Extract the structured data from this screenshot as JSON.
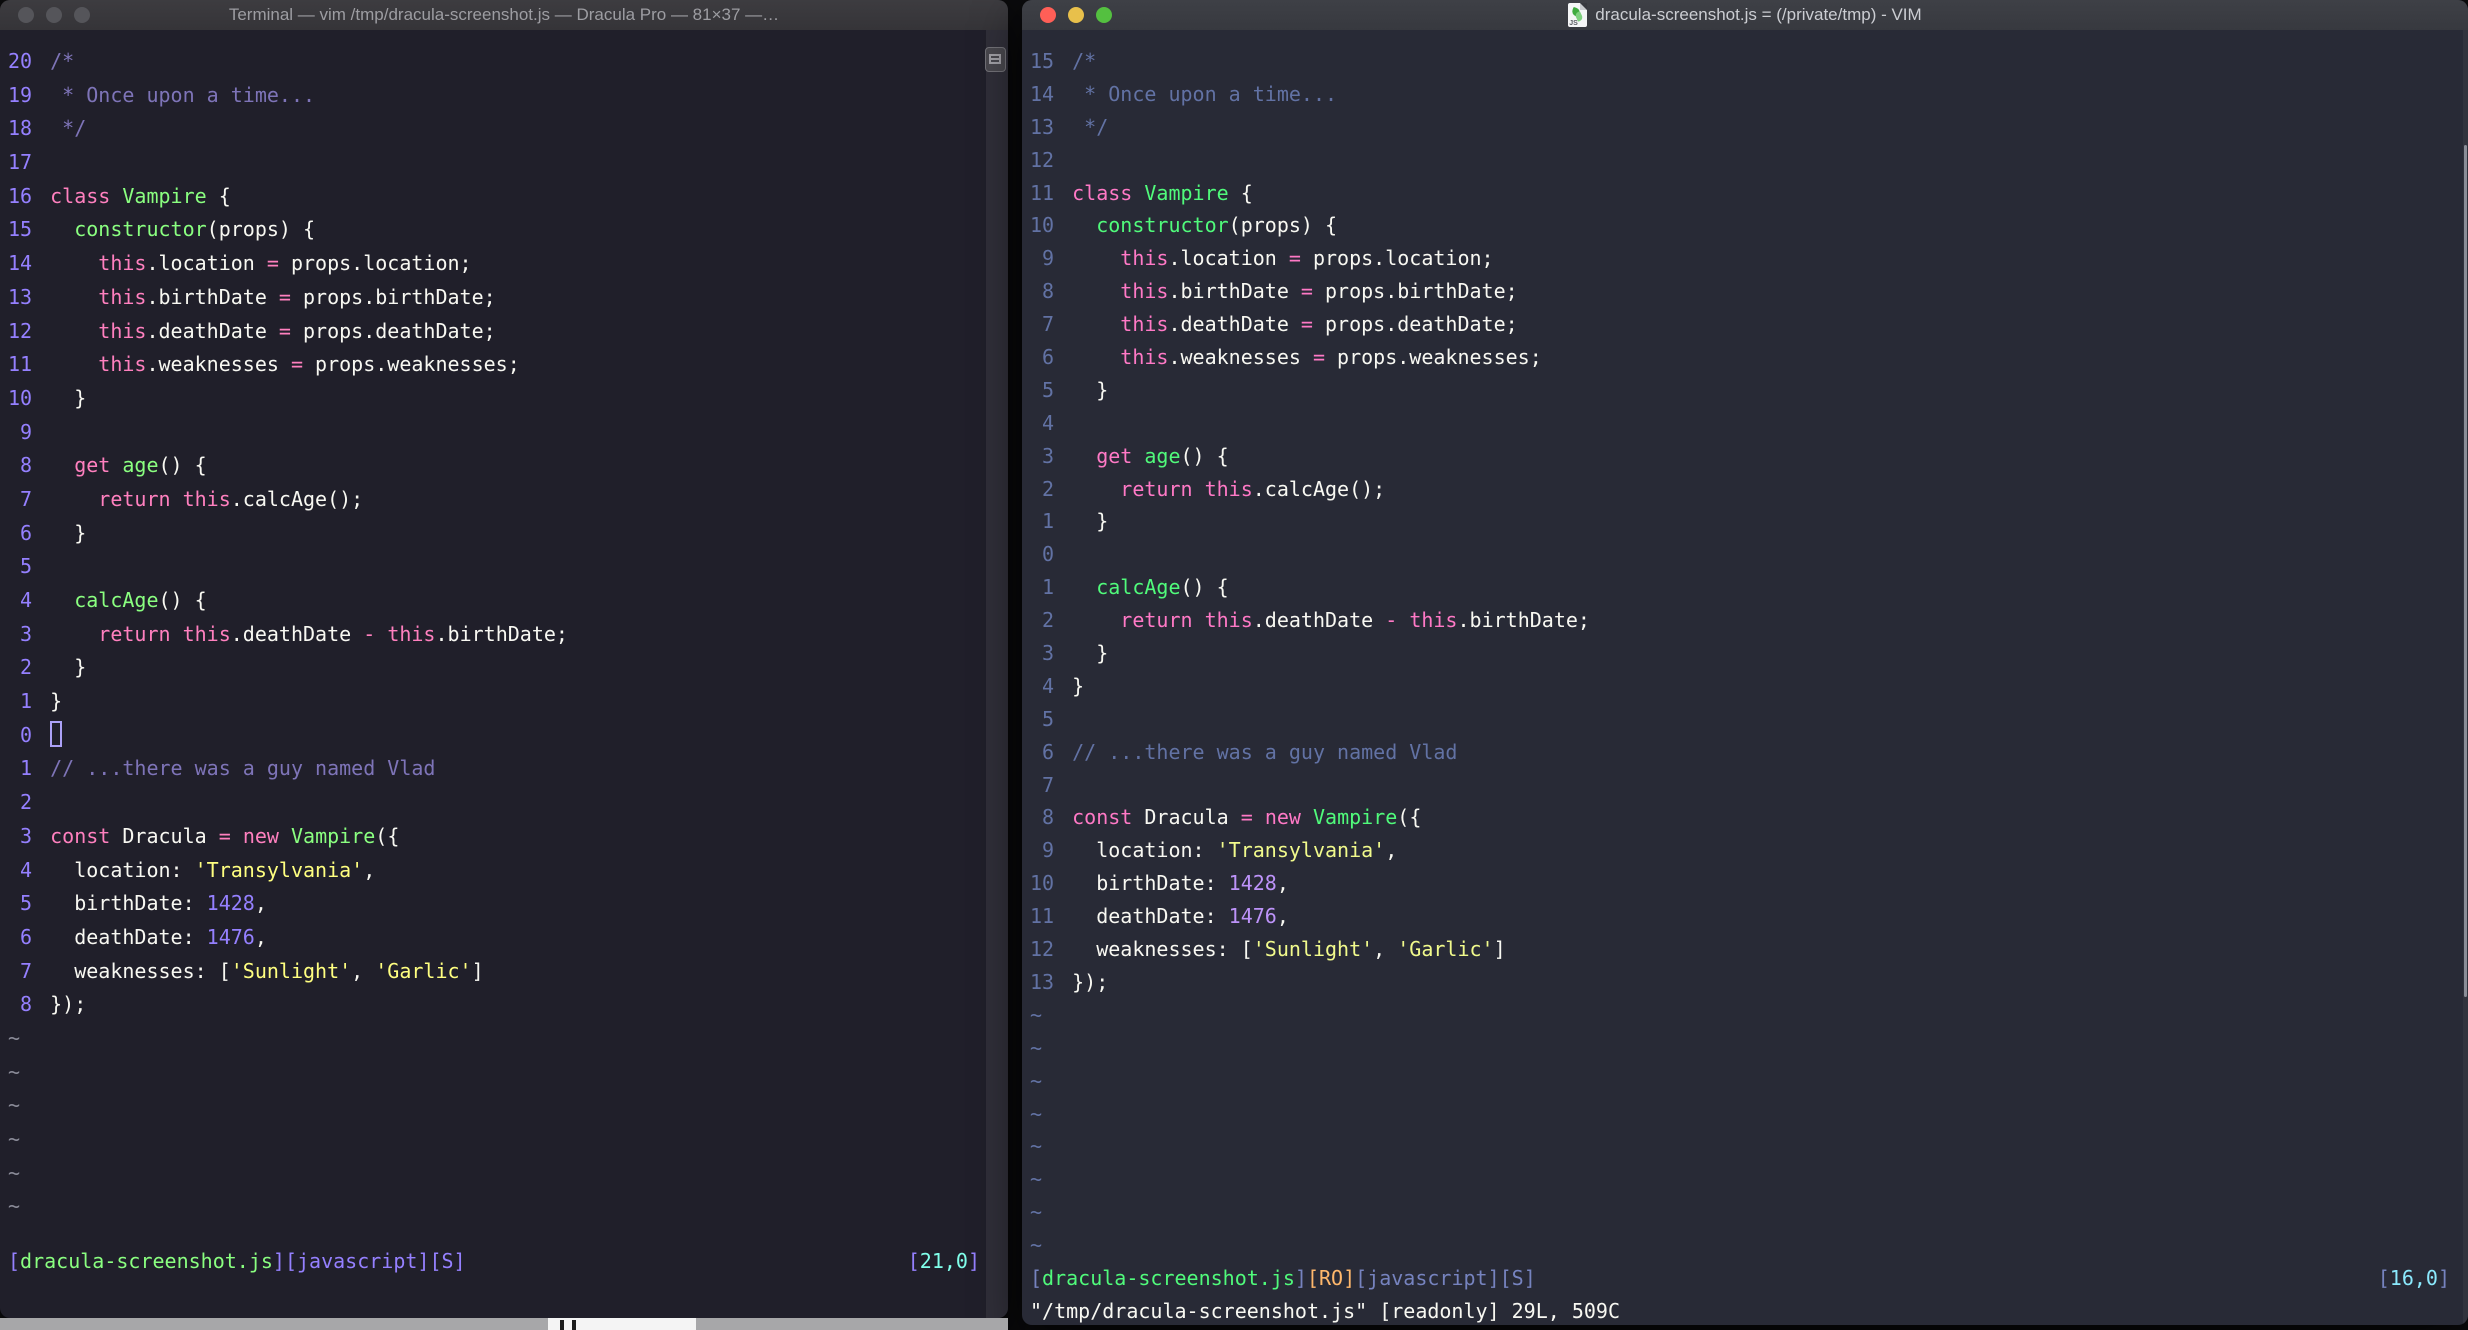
{
  "code": [
    {
      "segs": [
        [
          "com",
          "/*"
        ]
      ]
    },
    {
      "segs": [
        [
          "com",
          " * Once upon a time..."
        ]
      ]
    },
    {
      "segs": [
        [
          "com",
          " */"
        ]
      ]
    },
    {
      "segs": []
    },
    {
      "segs": [
        [
          "kw",
          "class"
        ],
        [
          "fg",
          " "
        ],
        [
          "fn",
          "Vampire"
        ],
        [
          "fg",
          " {"
        ]
      ]
    },
    {
      "segs": [
        [
          "fg",
          "  "
        ],
        [
          "fn",
          "constructor"
        ],
        [
          "fg",
          "(props) {"
        ]
      ]
    },
    {
      "segs": [
        [
          "fg",
          "    "
        ],
        [
          "kw",
          "this"
        ],
        [
          "fg",
          ".location "
        ],
        [
          "kw",
          "="
        ],
        [
          "fg",
          " props.location;"
        ]
      ]
    },
    {
      "segs": [
        [
          "fg",
          "    "
        ],
        [
          "kw",
          "this"
        ],
        [
          "fg",
          ".birthDate "
        ],
        [
          "kw",
          "="
        ],
        [
          "fg",
          " props.birthDate;"
        ]
      ]
    },
    {
      "segs": [
        [
          "fg",
          "    "
        ],
        [
          "kw",
          "this"
        ],
        [
          "fg",
          ".deathDate "
        ],
        [
          "kw",
          "="
        ],
        [
          "fg",
          " props.deathDate;"
        ]
      ]
    },
    {
      "segs": [
        [
          "fg",
          "    "
        ],
        [
          "kw",
          "this"
        ],
        [
          "fg",
          ".weaknesses "
        ],
        [
          "kw",
          "="
        ],
        [
          "fg",
          " props.weaknesses;"
        ]
      ]
    },
    {
      "segs": [
        [
          "fg",
          "  }"
        ]
      ]
    },
    {
      "segs": []
    },
    {
      "segs": [
        [
          "fg",
          "  "
        ],
        [
          "kw",
          "get"
        ],
        [
          "fg",
          " "
        ],
        [
          "fn",
          "age"
        ],
        [
          "fg",
          "() {"
        ]
      ]
    },
    {
      "segs": [
        [
          "fg",
          "    "
        ],
        [
          "kw",
          "return"
        ],
        [
          "fg",
          " "
        ],
        [
          "kw",
          "this"
        ],
        [
          "fg",
          ".calcAge();"
        ]
      ]
    },
    {
      "segs": [
        [
          "fg",
          "  }"
        ]
      ]
    },
    {
      "segs": []
    },
    {
      "segs": [
        [
          "fg",
          "  "
        ],
        [
          "fn",
          "calcAge"
        ],
        [
          "fg",
          "() {"
        ]
      ]
    },
    {
      "segs": [
        [
          "fg",
          "    "
        ],
        [
          "kw",
          "return"
        ],
        [
          "fg",
          " "
        ],
        [
          "kw",
          "this"
        ],
        [
          "fg",
          ".deathDate "
        ],
        [
          "kw",
          "-"
        ],
        [
          "fg",
          " "
        ],
        [
          "kw",
          "this"
        ],
        [
          "fg",
          ".birthDate;"
        ]
      ]
    },
    {
      "segs": [
        [
          "fg",
          "  }"
        ]
      ]
    },
    {
      "segs": [
        [
          "fg",
          "}"
        ]
      ]
    },
    {
      "segs": []
    },
    {
      "segs": [
        [
          "com",
          "// ...there was a guy named Vlad"
        ]
      ]
    },
    {
      "segs": []
    },
    {
      "segs": [
        [
          "kw",
          "const"
        ],
        [
          "fg",
          " Dracula "
        ],
        [
          "kw",
          "="
        ],
        [
          "fg",
          " "
        ],
        [
          "kw",
          "new"
        ],
        [
          "fg",
          " "
        ],
        [
          "fn",
          "Vampire"
        ],
        [
          "fg",
          "({"
        ]
      ]
    },
    {
      "segs": [
        [
          "fg",
          "  location: "
        ],
        [
          "st",
          "'Transylvania'"
        ],
        [
          "fg",
          ","
        ]
      ]
    },
    {
      "segs": [
        [
          "fg",
          "  birthDate: "
        ],
        [
          "nm",
          "1428"
        ],
        [
          "fg",
          ","
        ]
      ]
    },
    {
      "segs": [
        [
          "fg",
          "  deathDate: "
        ],
        [
          "nm",
          "1476"
        ],
        [
          "fg",
          ","
        ]
      ]
    },
    {
      "segs": [
        [
          "fg",
          "  weaknesses: ["
        ],
        [
          "st",
          "'Sunlight'"
        ],
        [
          "fg",
          ", "
        ],
        [
          "st",
          "'Garlic'"
        ],
        [
          "fg",
          "]"
        ]
      ]
    },
    {
      "segs": [
        [
          "fg",
          "});"
        ]
      ]
    }
  ],
  "left_window": {
    "title": "Terminal — vim /tmp/dracula-screenshot.js — Dracula Pro — 81×37 —…",
    "rel_numbers": [
      "20",
      "19",
      "18",
      "17",
      "16",
      "15",
      "14",
      "13",
      "12",
      "11",
      "10",
      "9",
      "8",
      "7",
      "6",
      "5",
      "4",
      "3",
      "2",
      "1",
      "0",
      "1",
      "2",
      "3",
      "4",
      "5",
      "6",
      "7",
      "8"
    ],
    "cursor_row": 20,
    "cursor_visible": true,
    "tilde_count": 6,
    "tilde_char": "~",
    "status_left": [
      [
        "p",
        "["
      ],
      [
        "g",
        "dracula-screenshot.js"
      ],
      [
        "p",
        "][javascript][S]"
      ]
    ],
    "status_right": [
      [
        "p",
        "["
      ],
      [
        "cy",
        "21,0"
      ],
      [
        "p",
        "]"
      ]
    ],
    "command_line": "",
    "colors": {
      "bg": "#201f2a",
      "fg": "#f8f8f2",
      "lnum": "#9580ff",
      "com": "#7e74b8",
      "kw": "#ff80bf",
      "fn": "#8aff80",
      "st": "#ffff80",
      "nm": "#9580ff",
      "p": "#9580ff",
      "g": "#8aff80",
      "cy": "#80ffea",
      "or": "#ffca80",
      "tilde": "#8a8b98",
      "cursor": "#aca1f7"
    },
    "traffic_lights": {
      "close": "#55555a",
      "minimize": "#55555a",
      "zoom": "#55555a"
    }
  },
  "right_window": {
    "title": "dracula-screenshot.js = (/private/tmp) - VIM",
    "icon": "js-document-icon",
    "rel_numbers": [
      "15",
      "14",
      "13",
      "12",
      "11",
      "10",
      "9",
      "8",
      "7",
      "6",
      "5",
      "4",
      "3",
      "2",
      "1",
      "0",
      "1",
      "2",
      "3",
      "4",
      "5",
      "6",
      "7",
      "8",
      "9",
      "10",
      "11",
      "12",
      "13"
    ],
    "cursor_row": 15,
    "cursor_visible": false,
    "tilde_count": 8,
    "tilde_char": "~",
    "status_left": [
      [
        "p",
        "["
      ],
      [
        "g",
        "dracula-screenshot.js"
      ],
      [
        "p",
        "]"
      ],
      [
        "or",
        "[RO]"
      ],
      [
        "p",
        "[javascript][S]"
      ]
    ],
    "status_right": [
      [
        "p",
        "["
      ],
      [
        "cy",
        "16,0"
      ],
      [
        "p",
        "]"
      ]
    ],
    "command_line": "\"/tmp/dracula-screenshot.js\" [readonly] 29L, 509C",
    "colors": {
      "bg": "#282a36",
      "fg": "#f8f8f2",
      "lnum": "#6272a4",
      "com": "#6272a4",
      "kw": "#ff79c6",
      "fn": "#50fa7b",
      "st": "#f1fa8c",
      "nm": "#bd93f9",
      "p": "#7683bf",
      "g": "#50fa7b",
      "cy": "#8be9fd",
      "or": "#ffb86c",
      "tilde": "#6272a4",
      "cursor": "#f8f8f2"
    },
    "traffic_lights": {
      "close": "#ff5f57",
      "minimize": "#e8c04b",
      "zoom": "#54c040"
    }
  }
}
